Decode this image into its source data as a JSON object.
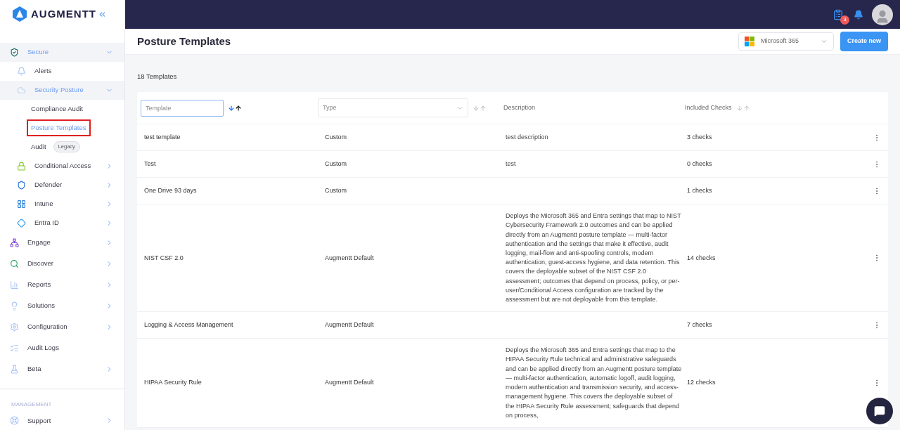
{
  "brand": {
    "name": "AUGMENTT"
  },
  "sidebar": {
    "items": [
      {
        "label": "Secure",
        "expanded": true,
        "selected": false,
        "children": [
          {
            "label": "Alerts",
            "selected": false,
            "has_children": false
          },
          {
            "label": "Security Posture",
            "expanded": true,
            "selected": false,
            "children": [
              {
                "label": "Compliance Audit",
                "selected": false,
                "has_children": false
              },
              {
                "label": "Posture Templates",
                "selected": true,
                "has_children": false
              },
              {
                "label": "Audit",
                "badge": "Legacy",
                "selected": false,
                "has_children": false
              }
            ]
          },
          {
            "label": "Conditional Access",
            "selected": false,
            "has_children": true
          },
          {
            "label": "Defender",
            "selected": false,
            "has_children": true
          },
          {
            "label": "Intune",
            "selected": false,
            "has_children": true
          },
          {
            "label": "Entra ID",
            "selected": false,
            "has_children": true
          }
        ]
      },
      {
        "label": "Engage",
        "selected": false,
        "has_children": true
      },
      {
        "label": "Discover",
        "selected": false,
        "has_children": true
      },
      {
        "label": "Reports",
        "selected": false,
        "has_children": true
      },
      {
        "label": "Solutions",
        "selected": false,
        "has_children": true
      },
      {
        "label": "Configuration",
        "selected": false,
        "has_children": true
      },
      {
        "label": "Audit Logs",
        "selected": false,
        "has_children": false
      },
      {
        "label": "Beta",
        "selected": false,
        "has_children": true
      }
    ],
    "section": "MANAGEMENT",
    "section_items": [
      {
        "label": "Support",
        "selected": false,
        "has_children": true
      }
    ]
  },
  "topbar": {
    "tasks_badge": "3"
  },
  "header": {
    "title": "Posture Templates",
    "platform": "Microsoft 365",
    "create_button": "Create new"
  },
  "count": "18 Templates",
  "table": {
    "columns": [
      {
        "kind": "input",
        "placeholder": "Template",
        "sorted": true
      },
      {
        "kind": "select",
        "placeholder": "Type",
        "sorted": false
      },
      {
        "kind": "text",
        "label": "Description"
      },
      {
        "kind": "text",
        "label": "Included Checks",
        "sorted": false
      }
    ],
    "rows": [
      {
        "name": "test template",
        "type": "Custom",
        "description": "test description",
        "checks": "3 checks"
      },
      {
        "name": "Test",
        "type": "Custom",
        "description": "test",
        "checks": "0 checks"
      },
      {
        "name": "One Drive 93 days",
        "type": "Custom",
        "checks": "1 checks"
      },
      {
        "name": "NIST CSF 2.0",
        "type": "Augmentt Default",
        "description": "Deploys the Microsoft 365 and Entra settings that map to NIST Cybersecurity Framework 2.0 outcomes and can be applied directly from an Augmentt posture template — multi-factor authentication and the settings that make it effective, audit logging, mail-flow and anti-spoofing controls, modern authentication, guest-access hygiene, and data retention. This covers the deployable subset of the NIST CSF 2.0 assessment; outcomes that depend on process, policy, or per-user/Conditional Access configuration are tracked by the assessment but are not deployable from this template.",
        "checks": "14 checks"
      },
      {
        "name": "Logging & Access Management",
        "type": "Augmentt Default",
        "checks": "7 checks"
      },
      {
        "name": "HIPAA Security Rule",
        "type": "Augmentt Default",
        "description": "Deploys the Microsoft 365 and Entra settings that map to the HIPAA Security Rule technical and administrative safeguards and can be applied directly from an Augmentt posture template — multi-factor authentication, automatic logoff, audit logging, modern authentication and transmission security, and access-management hygiene. This covers the deployable subset of the HIPAA Security Rule assessment; safeguards that depend on process,",
        "checks": "12 checks"
      }
    ]
  }
}
